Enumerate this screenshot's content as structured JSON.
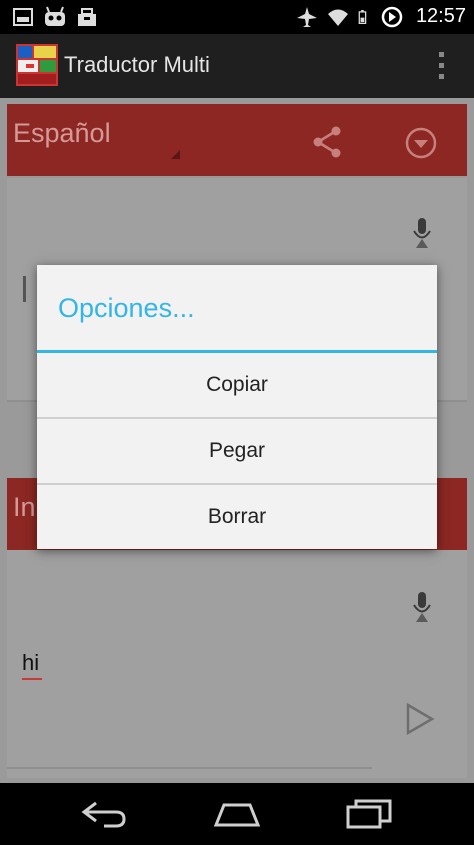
{
  "status_bar": {
    "time": "12:57",
    "icons": [
      "picture-icon",
      "android-icon",
      "briefcase-icon",
      "airplane-icon",
      "wifi-icon",
      "battery-icon",
      "alarm-icon"
    ]
  },
  "app_bar": {
    "title": "Traductor Multi",
    "icons": [
      "app-flags-icon",
      "overflow-menu-icon"
    ]
  },
  "source_panel": {
    "language": "Español",
    "icons": [
      "share-icon",
      "dropdown-icon",
      "microphone-icon"
    ]
  },
  "target_panel": {
    "language": "In",
    "output_text": "hi",
    "icons": [
      "microphone-icon",
      "play-icon"
    ]
  },
  "dialog": {
    "title": "Opciones...",
    "items": [
      {
        "label": "Copiar"
      },
      {
        "label": "Pegar"
      },
      {
        "label": "Borrar"
      }
    ]
  },
  "colors": {
    "accent": "#33b5e5",
    "language_bar": "#8c2723",
    "dim_background": "#9a9a9a"
  },
  "nav_bar": {
    "icons": [
      "back-icon",
      "home-icon",
      "recent-apps-icon"
    ]
  }
}
